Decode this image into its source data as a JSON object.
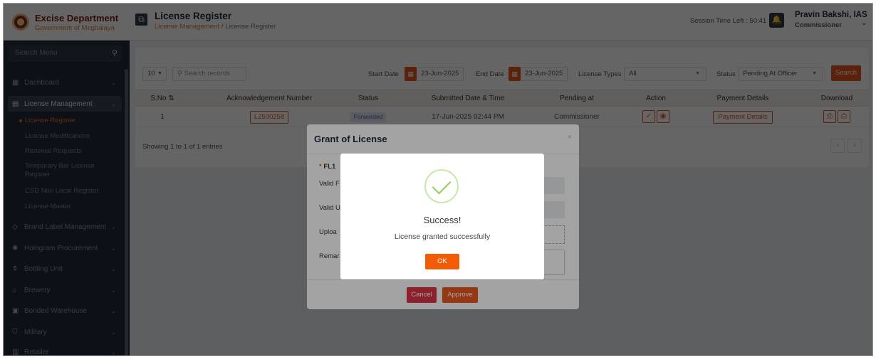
{
  "brand": {
    "title": "Excise Department",
    "subtitle": "Government of Meghalaya"
  },
  "header": {
    "page_title": "License Register",
    "breadcrumb": {
      "parent": "License Management",
      "separator": "/",
      "current": "License Register"
    },
    "session_label": "Session Time Left : 50:41",
    "user_name": "Pravin Bakshi, IAS",
    "user_role": "Commissioner"
  },
  "sidebar": {
    "search_placeholder": "Search Menu",
    "items": [
      {
        "label": "Dashboard",
        "icon": "grid-icon"
      },
      {
        "label": "License Management",
        "icon": "id-card-icon"
      },
      {
        "label": "Brand Label Management",
        "icon": "tag-icon"
      },
      {
        "label": "Hologram Procurement",
        "icon": "hologram-icon"
      },
      {
        "label": "Bottling Unit",
        "icon": "bottle-icon"
      },
      {
        "label": "Brewery",
        "icon": "factory-icon"
      },
      {
        "label": "Bonded Warehouse",
        "icon": "warehouse-icon"
      },
      {
        "label": "Military",
        "icon": "shield-icon"
      },
      {
        "label": "Retailer",
        "icon": "store-icon"
      }
    ],
    "sub_items": [
      {
        "label": "License Register"
      },
      {
        "label": "License Modifications"
      },
      {
        "label": "Renewal Requests"
      },
      {
        "label": "Temporary Bar License Register"
      },
      {
        "label": "CSD Non Local Register"
      },
      {
        "label": "License Master"
      }
    ]
  },
  "filters": {
    "page_length": "10",
    "search_placeholder": "Search records",
    "start_label": "Start Date",
    "start_value": "23-Jun-2025",
    "end_label": "End Date",
    "end_value": "23-Jun-2025",
    "types_label": "License Types",
    "types_value": "All",
    "status_label": "Status",
    "status_value": "Pending At Officer",
    "search_button": "Search"
  },
  "table": {
    "columns": [
      "S.No",
      "Acknowledgement Number",
      "Status",
      "Submitted Date & Time",
      "Pending at",
      "Action",
      "Payment Details",
      "Download"
    ],
    "rows": [
      {
        "sno": "1",
        "ack": "L2500258",
        "status": "Forwarded",
        "submitted": "17-Jun-2025 02:44 PM",
        "pending": "Commissioner",
        "payment": "Payment Details"
      }
    ],
    "showing": "Showing 1 to 1 of 1 entries"
  },
  "grant_modal": {
    "title": "Grant of License",
    "section_label": "FL1",
    "fields": [
      "Valid F",
      "Valid U",
      "Uploa",
      "Remar"
    ],
    "cancel": "Cancel",
    "approve": "Approve"
  },
  "alert": {
    "title": "Success!",
    "message": "License granted successfully",
    "ok": "OK"
  }
}
